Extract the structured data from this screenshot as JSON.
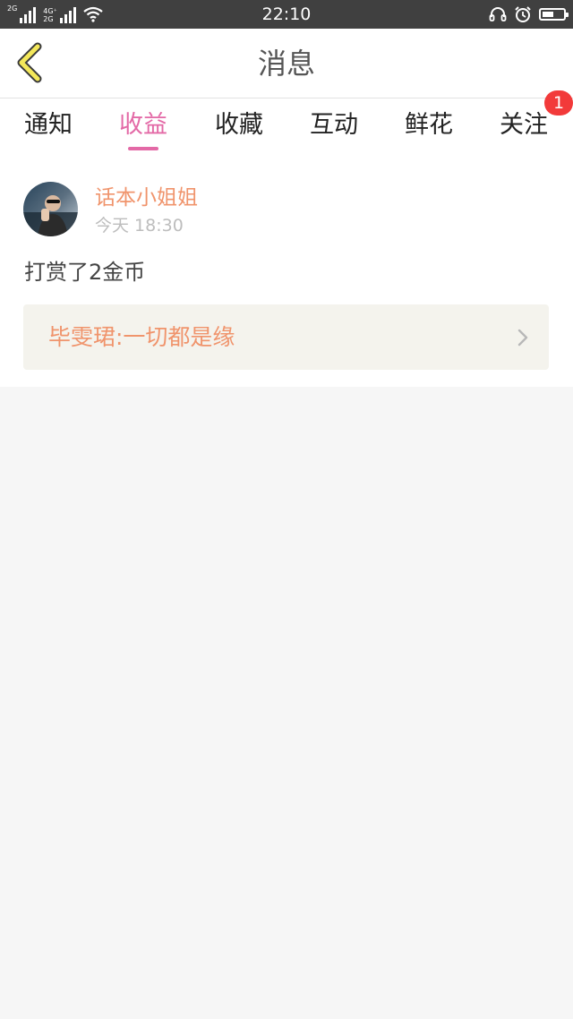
{
  "status_bar": {
    "time": "22:10",
    "network_1": "2G",
    "network_2_top": "4G⁺",
    "network_2_bottom": "2G",
    "battery_level": 0.55
  },
  "header": {
    "title": "消息"
  },
  "tabs": [
    {
      "label": "通知"
    },
    {
      "label": "收益"
    },
    {
      "label": "收藏"
    },
    {
      "label": "互动"
    },
    {
      "label": "鲜花"
    },
    {
      "label": "关注"
    }
  ],
  "active_tab": "收益",
  "badge_count": "1",
  "notification": {
    "user_name": "话本小姐姐",
    "timestamp": "今天 18:30",
    "message": "打赏了2金币",
    "link_text": "毕雯珺:一切都是缘"
  },
  "colors": {
    "accent": "#e369a6",
    "orange": "#f0946c",
    "badge": "#f23a3a",
    "back_arrow_fill": "#f4e85a"
  }
}
